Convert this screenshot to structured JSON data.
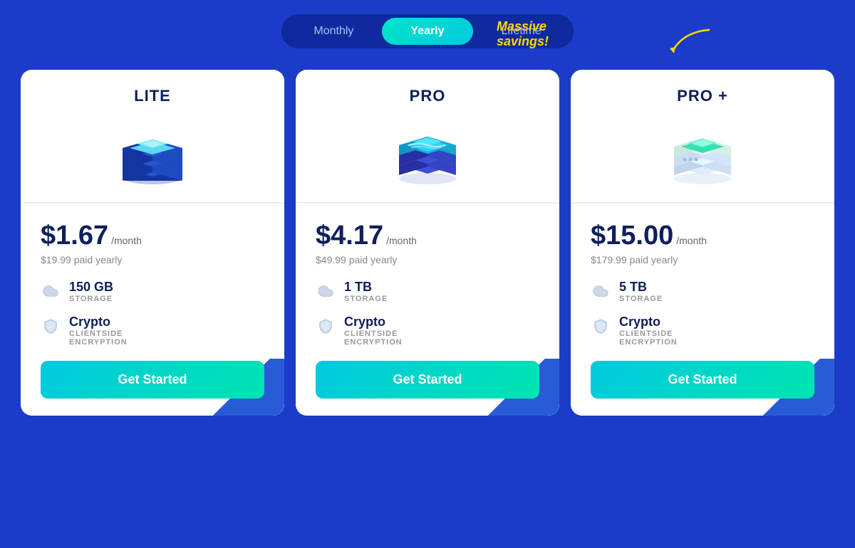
{
  "header": {
    "tabs": [
      {
        "id": "monthly",
        "label": "Monthly",
        "active": false
      },
      {
        "id": "yearly",
        "label": "Yearly",
        "active": true
      },
      {
        "id": "lifetime",
        "label": "Lifetime",
        "active": false
      }
    ],
    "savings_label": "Massive savings!"
  },
  "plans": [
    {
      "id": "lite",
      "name": "LITE",
      "price_main": "$1.67",
      "price_period": "/month",
      "price_yearly": "$19.99 paid yearly",
      "features": [
        {
          "icon": "cloud",
          "value": "150 GB",
          "label": "STORAGE"
        },
        {
          "icon": "shield",
          "value": "Crypto",
          "label": "CLIENTSIDE\nENCRYPTION"
        }
      ],
      "cta": "Get Started"
    },
    {
      "id": "pro",
      "name": "PRO",
      "price_main": "$4.17",
      "price_period": "/month",
      "price_yearly": "$49.99 paid yearly",
      "features": [
        {
          "icon": "cloud",
          "value": "1 TB",
          "label": "STORAGE"
        },
        {
          "icon": "shield",
          "value": "Crypto",
          "label": "CLIENTSIDE\nENCRYPTION"
        }
      ],
      "cta": "Get Started"
    },
    {
      "id": "proplus",
      "name": "PRO +",
      "price_main": "$15.00",
      "price_period": "/month",
      "price_yearly": "$179.99 paid yearly",
      "features": [
        {
          "icon": "cloud",
          "value": "5 TB",
          "label": "STORAGE"
        },
        {
          "icon": "shield",
          "value": "Crypto",
          "label": "CLIENTSIDE\nENCRYPTION"
        }
      ],
      "cta": "Get Started"
    }
  ]
}
